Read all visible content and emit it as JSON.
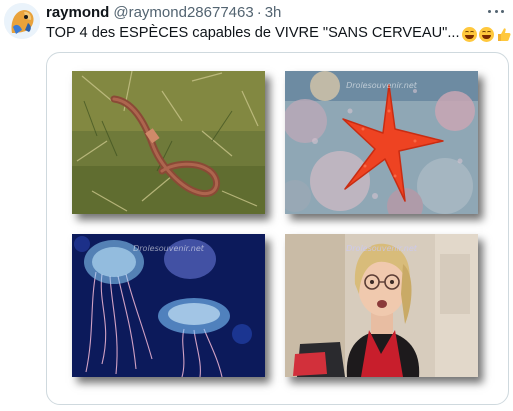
{
  "tweet": {
    "author_name": "raymond",
    "author_handle": "@raymond28677463",
    "separator": "·",
    "time": "3h",
    "text": "TOP 4 des ESPÈCES capables de VIVRE \"SANS CERVEAU\"...",
    "emojis": [
      "face-with-tears-of-joy",
      "face-with-tears-of-joy",
      "thumbs-up"
    ],
    "more_icon": "more-horizontal-icon"
  },
  "media": {
    "watermark": "Drolesouvenir.net",
    "images": [
      {
        "subject": "earthworm-on-grass"
      },
      {
        "subject": "red-starfish-on-coral"
      },
      {
        "subject": "jellyfish-glowing-blue"
      },
      {
        "subject": "woman-with-glasses-red-blouse"
      }
    ]
  },
  "colors": {
    "text": "#0f1419",
    "secondary": "#536471",
    "border": "#cfd9de"
  }
}
